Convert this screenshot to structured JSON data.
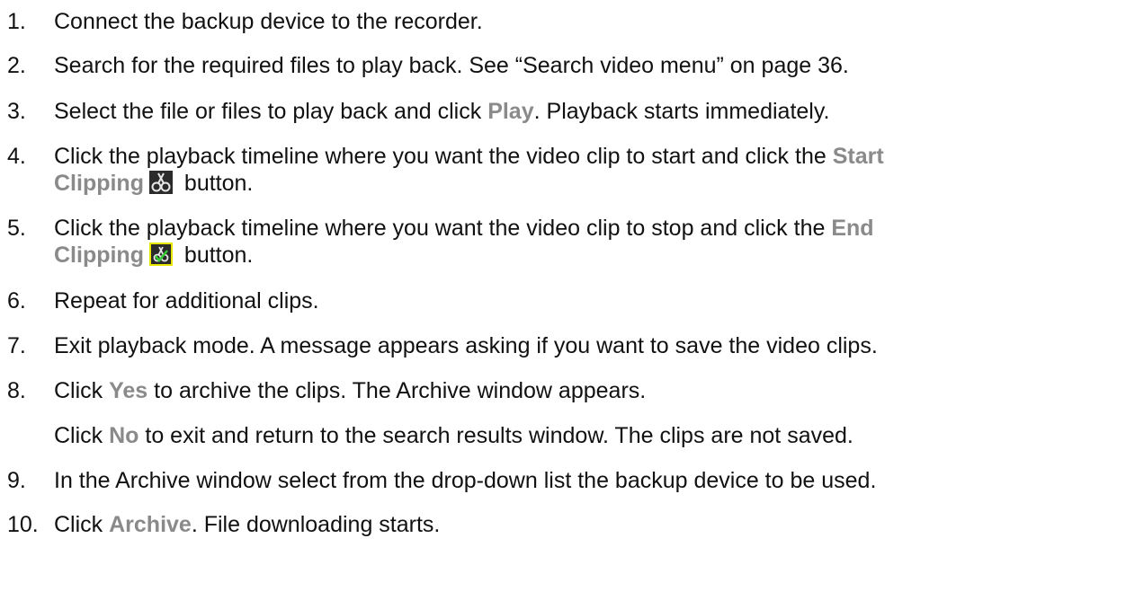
{
  "steps": [
    {
      "num": "1.",
      "text": "Connect the backup device to the recorder."
    },
    {
      "num": "2.",
      "text": "Search for the required files to play back. See “Search video menu” on page 36."
    },
    {
      "num": "3.",
      "a": "Select the file or files to play back and click ",
      "ui": "Play",
      "b": ". Playback starts immediately."
    },
    {
      "num": "4.",
      "a": "Click the playback timeline where you want the video clip to start and click the ",
      "ui1": "Start",
      "ui2": "Clipping",
      "b": " button.",
      "icon": "start-clipping-icon"
    },
    {
      "num": "5.",
      "a": "Click the playback timeline where you want the video clip to stop and click the ",
      "ui1": "End",
      "ui2": "Clipping",
      "b": " button.",
      "icon": "end-clipping-icon"
    },
    {
      "num": "6.",
      "text": "Repeat for additional clips."
    },
    {
      "num": "7.",
      "text": "Exit playback mode. A message appears asking if you want to save the video clips."
    },
    {
      "num": "8.",
      "a": "Click ",
      "ui": "Yes",
      "b": " to archive the clips. The Archive window appears."
    },
    {
      "num": "",
      "a": "Click ",
      "ui": "No",
      "b": " to exit and return to the search results window. The clips are not saved."
    },
    {
      "num": "9.",
      "text": "In the Archive window select from the drop-down list the backup device to be used."
    },
    {
      "num": "10.",
      "a": "Click ",
      "ui": "Archive",
      "b": ". File downloading starts."
    }
  ],
  "colors": {
    "ui_term": "#8a8a8a",
    "end_clipping_icon_border": "#e6e600"
  }
}
